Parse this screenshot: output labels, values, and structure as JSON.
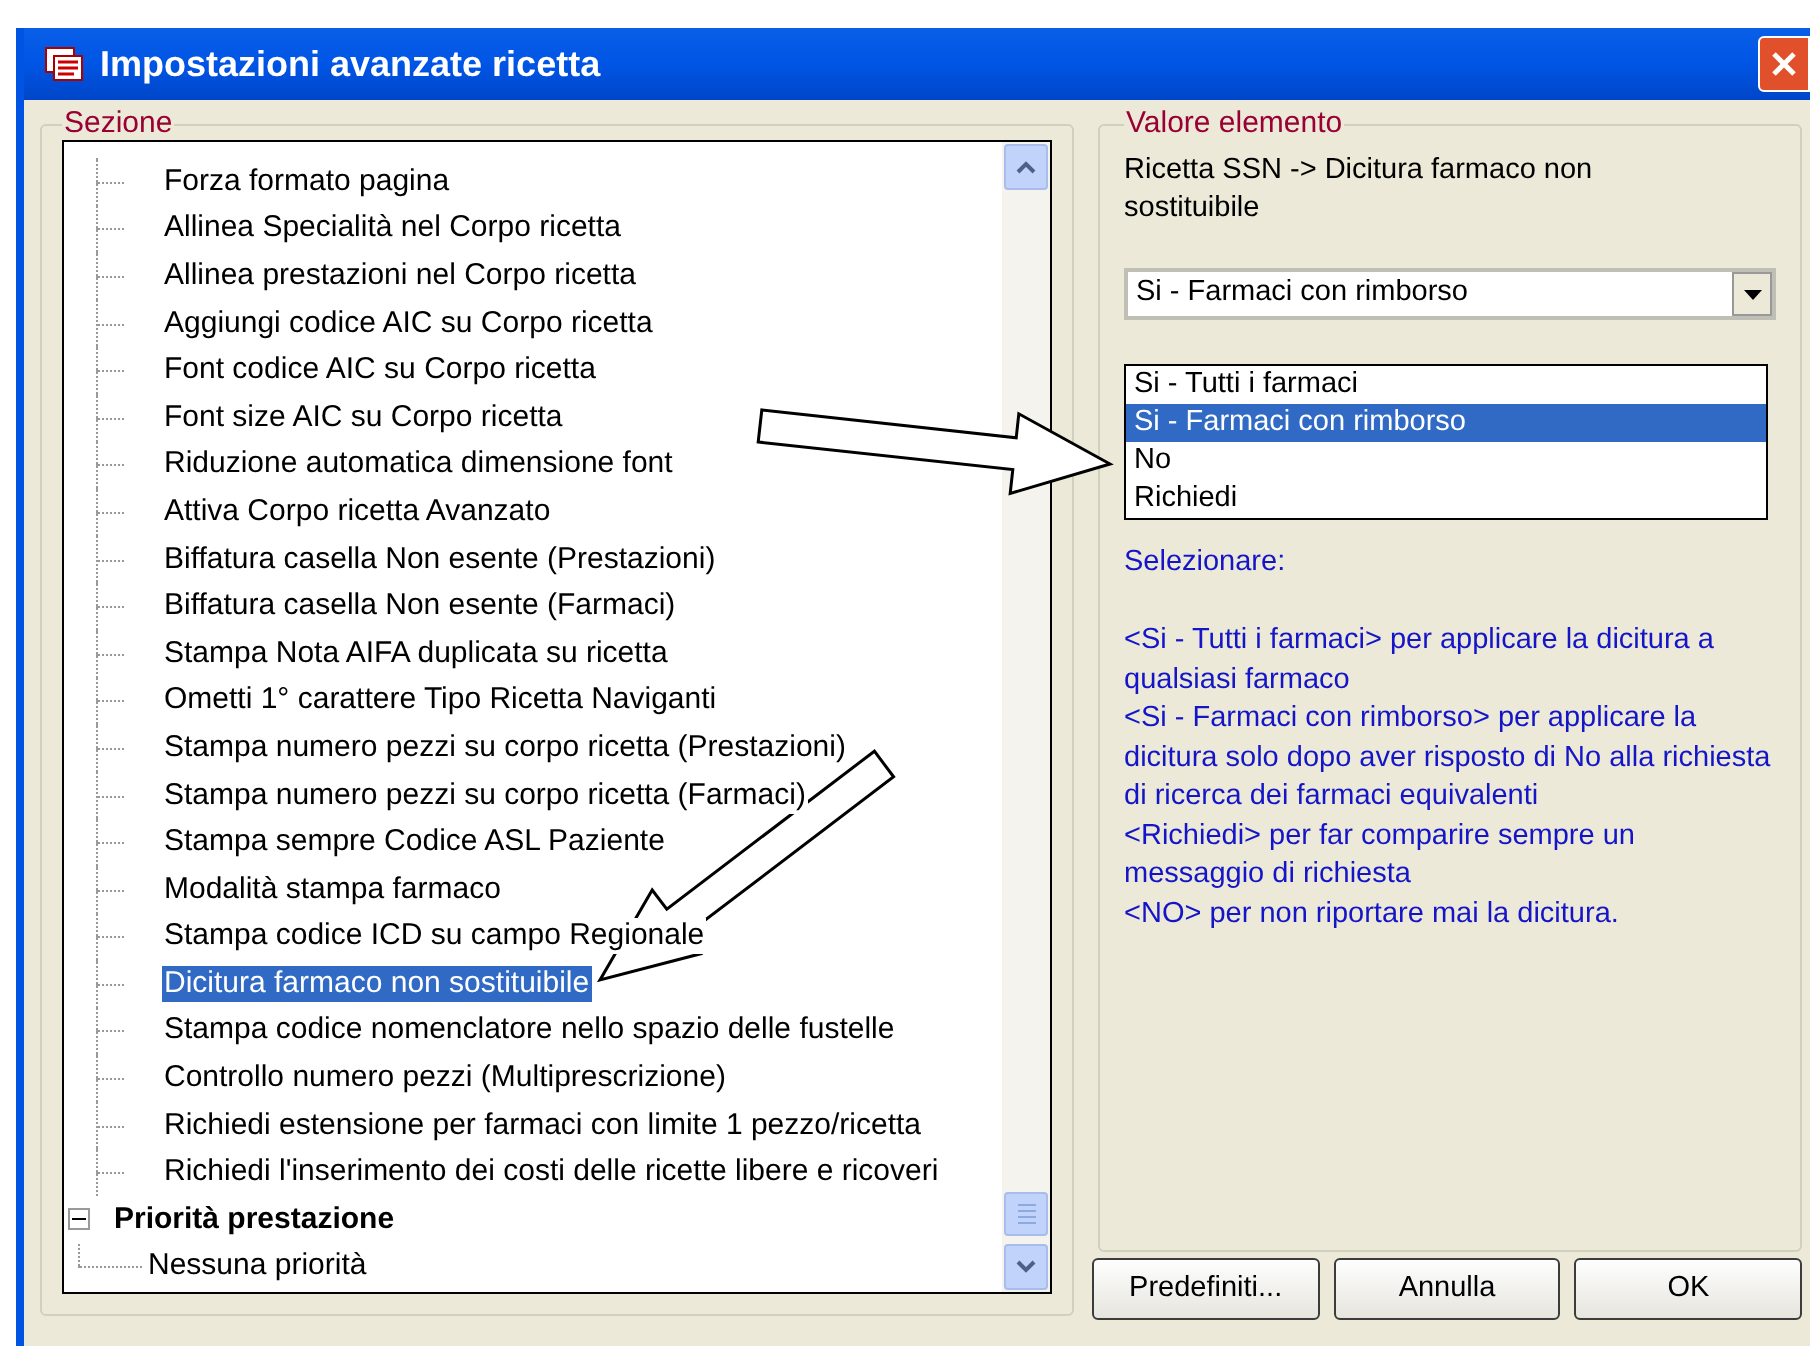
{
  "window": {
    "title": "Impostazioni avanzate ricetta"
  },
  "section": {
    "legend": "Sezione",
    "items": [
      {
        "label": "Forza formato pagina",
        "selected": false
      },
      {
        "label": "Allinea Specialità nel Corpo ricetta",
        "selected": false
      },
      {
        "label": "Allinea prestazioni nel Corpo ricetta",
        "selected": false
      },
      {
        "label": "Aggiungi codice AIC su Corpo ricetta",
        "selected": false
      },
      {
        "label": "Font codice AIC su Corpo ricetta",
        "selected": false
      },
      {
        "label": "Font size AIC su Corpo ricetta",
        "selected": false
      },
      {
        "label": "Riduzione automatica dimensione font",
        "selected": false
      },
      {
        "label": "Attiva Corpo ricetta Avanzato",
        "selected": false
      },
      {
        "label": "Biffatura casella Non esente (Prestazioni)",
        "selected": false
      },
      {
        "label": "Biffatura casella Non esente (Farmaci)",
        "selected": false
      },
      {
        "label": "Stampa Nota AIFA duplicata su ricetta",
        "selected": false
      },
      {
        "label": "Ometti 1° carattere Tipo Ricetta Naviganti",
        "selected": false
      },
      {
        "label": "Stampa numero pezzi su corpo ricetta (Prestazioni)",
        "selected": false
      },
      {
        "label": "Stampa numero pezzi su corpo ricetta (Farmaci)",
        "selected": false
      },
      {
        "label": "Stampa sempre Codice ASL Paziente",
        "selected": false
      },
      {
        "label": "Modalità stampa farmaco",
        "selected": false
      },
      {
        "label": "Stampa codice ICD su campo Regionale",
        "selected": false
      },
      {
        "label": "Dicitura farmaco non sostituibile",
        "selected": true
      },
      {
        "label": "Stampa codice nomenclatore nello spazio delle fustelle",
        "selected": false
      },
      {
        "label": "Controllo numero pezzi (Multiprescrizione)",
        "selected": false
      },
      {
        "label": "Richiedi estensione per farmaci con limite 1 pezzo/ricetta",
        "selected": false
      },
      {
        "label": "Richiedi l'inserimento dei costi delle ricette libere e ricoveri",
        "selected": false
      }
    ],
    "groups": [
      {
        "label": "Priorità prestazione",
        "expanded": true,
        "children": [
          {
            "label": "Nessuna priorità",
            "selected": false
          }
        ]
      }
    ]
  },
  "value": {
    "legend": "Valore elemento",
    "path": "Ricetta SSN -> Dicitura farmaco non sostituibile",
    "combo_value": "Si - Farmaci con rimborso",
    "options": [
      {
        "label": "Si - Tutti i farmaci",
        "selected": false
      },
      {
        "label": "Si - Farmaci con rimborso",
        "selected": true
      },
      {
        "label": "No",
        "selected": false
      },
      {
        "label": "Richiedi",
        "selected": false
      }
    ],
    "help": {
      "heading": "Selezionare:",
      "lines": [
        "<Si - Tutti i farmaci> per applicare la dicitura a qualsiasi farmaco",
        "<Si - Farmaci con rimborso> per applicare la dicitura solo dopo aver risposto di No alla richiesta di ricerca dei farmaci equivalenti",
        "<Richiedi> per far comparire sempre un messaggio di richiesta",
        "<NO> per non riportare mai la dicitura."
      ]
    }
  },
  "buttons": [
    "Predefiniti...",
    "Annulla",
    "OK"
  ]
}
